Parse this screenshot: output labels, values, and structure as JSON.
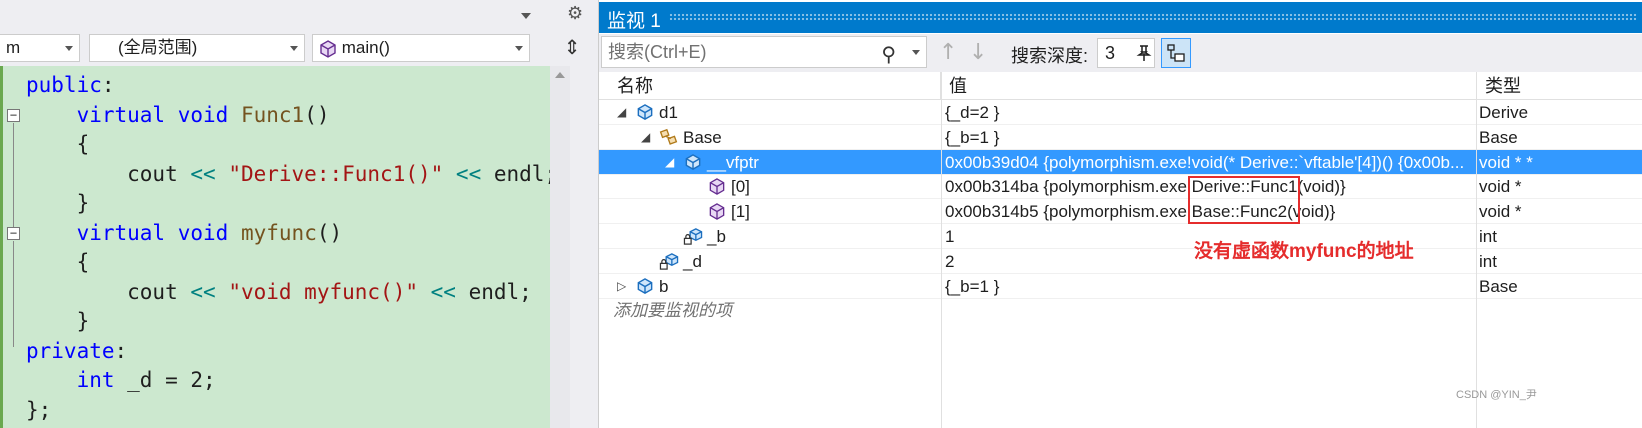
{
  "editor": {
    "nav": {
      "project_combo": "m",
      "scope_combo": "(全局范围)",
      "member_combo": "main()"
    },
    "code_lines": [
      [
        {
          "t": "public",
          "c": "kw"
        },
        {
          "t": ":",
          "c": ""
        }
      ],
      [
        {
          "t": "    ",
          "c": ""
        },
        {
          "t": "virtual",
          "c": "kw"
        },
        {
          "t": " ",
          "c": ""
        },
        {
          "t": "void",
          "c": "kw"
        },
        {
          "t": " ",
          "c": ""
        },
        {
          "t": "Func1",
          "c": "fn"
        },
        {
          "t": "()",
          "c": ""
        }
      ],
      [
        {
          "t": "    {",
          "c": ""
        }
      ],
      [
        {
          "t": "        cout ",
          "c": ""
        },
        {
          "t": "<<",
          "c": "op"
        },
        {
          "t": " ",
          "c": ""
        },
        {
          "t": "\"Derive::Func1()\"",
          "c": "str"
        },
        {
          "t": " ",
          "c": ""
        },
        {
          "t": "<<",
          "c": "op"
        },
        {
          "t": " endl;",
          "c": ""
        }
      ],
      [
        {
          "t": "    }",
          "c": ""
        }
      ],
      [
        {
          "t": "    ",
          "c": ""
        },
        {
          "t": "virtual",
          "c": "kw"
        },
        {
          "t": " ",
          "c": ""
        },
        {
          "t": "void",
          "c": "kw"
        },
        {
          "t": " ",
          "c": ""
        },
        {
          "t": "myfunc",
          "c": "fn"
        },
        {
          "t": "()",
          "c": ""
        }
      ],
      [
        {
          "t": "    {",
          "c": ""
        }
      ],
      [
        {
          "t": "        cout ",
          "c": ""
        },
        {
          "t": "<<",
          "c": "op"
        },
        {
          "t": " ",
          "c": ""
        },
        {
          "t": "\"void myfunc()\"",
          "c": "str"
        },
        {
          "t": " ",
          "c": ""
        },
        {
          "t": "<<",
          "c": "op"
        },
        {
          "t": " endl;",
          "c": ""
        }
      ],
      [
        {
          "t": "    }",
          "c": ""
        }
      ],
      [
        {
          "t": "private",
          "c": "kw"
        },
        {
          "t": ":",
          "c": ""
        }
      ],
      [
        {
          "t": "    ",
          "c": ""
        },
        {
          "t": "int",
          "c": "kw"
        },
        {
          "t": " _d = 2;",
          "c": ""
        }
      ],
      [
        {
          "t": "};",
          "c": ""
        }
      ]
    ]
  },
  "watch": {
    "title": "监视 1",
    "search_placeholder": "搜索(Ctrl+E)",
    "depth_label": "搜索深度:",
    "depth_value": "3",
    "columns": {
      "name": "名称",
      "value": "值",
      "type": "类型"
    },
    "rows": [
      {
        "name": "d1",
        "value": "{_d=2 }",
        "type": "Derive",
        "level": 0,
        "expand": "open",
        "icon": "object"
      },
      {
        "name": "Base",
        "value": "{_b=1 }",
        "type": "Base",
        "level": 1,
        "expand": "open",
        "icon": "base-class"
      },
      {
        "name": "__vfptr",
        "value": "0x00b39d04 {polymorphism.exe!void(* Derive::`vftable'[4])() {0x00b...",
        "type": "void * *",
        "level": 2,
        "expand": "open",
        "icon": "object",
        "selected": true
      },
      {
        "name": "[0]",
        "value": "0x00b314ba {polymorphism.exe!Derive::Func1(void)}",
        "type": "void *",
        "level": 3,
        "expand": "none",
        "icon": "method"
      },
      {
        "name": "[1]",
        "value": "0x00b314b5 {polymorphism.exe!Base::Func2(void)}",
        "type": "void *",
        "level": 3,
        "expand": "none",
        "icon": "method"
      },
      {
        "name": "_b",
        "value": "1",
        "type": "int",
        "level": 2,
        "expand": "none",
        "icon": "private-field"
      },
      {
        "name": "_d",
        "value": "2",
        "type": "int",
        "level": 1,
        "expand": "none",
        "icon": "private-field"
      },
      {
        "name": "b",
        "value": "{_b=1 }",
        "type": "Base",
        "level": 0,
        "expand": "closed",
        "icon": "object"
      }
    ],
    "add_watch": "添加要监视的项",
    "annotation": "没有虚函数myfunc的地址"
  },
  "watermark": "CSDN @YIN_尹",
  "colors": {
    "title_bar": "#007acc",
    "selection": "#3399ff",
    "code_bg": "#cce8cf",
    "keyword": "#0000ff",
    "string": "#a31515",
    "annotation": "#e52c2c"
  }
}
